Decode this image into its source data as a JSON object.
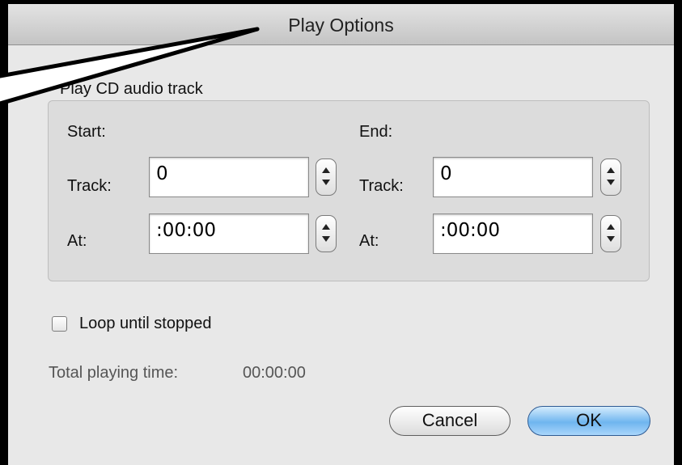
{
  "window": {
    "title": "Play Options"
  },
  "group": {
    "label": "Play CD audio track"
  },
  "start": {
    "heading": "Start:",
    "track_label": "Track:",
    "track_value": "0",
    "at_label": "At:",
    "at_value": ":00:00"
  },
  "end": {
    "heading": "End:",
    "track_label": "Track:",
    "track_value": "0",
    "at_label": "At:",
    "at_value": ":00:00"
  },
  "loop": {
    "label": "Loop until stopped",
    "checked": false
  },
  "total": {
    "label": "Total playing time:",
    "value": "00:00:00"
  },
  "buttons": {
    "cancel": "Cancel",
    "ok": "OK"
  },
  "colors": {
    "default_button": "#6fb5ef",
    "group_background": "#dcdcdc",
    "window_background": "#e8e8e8"
  },
  "icons": {
    "stepper": "stepper-arrows-icon"
  }
}
